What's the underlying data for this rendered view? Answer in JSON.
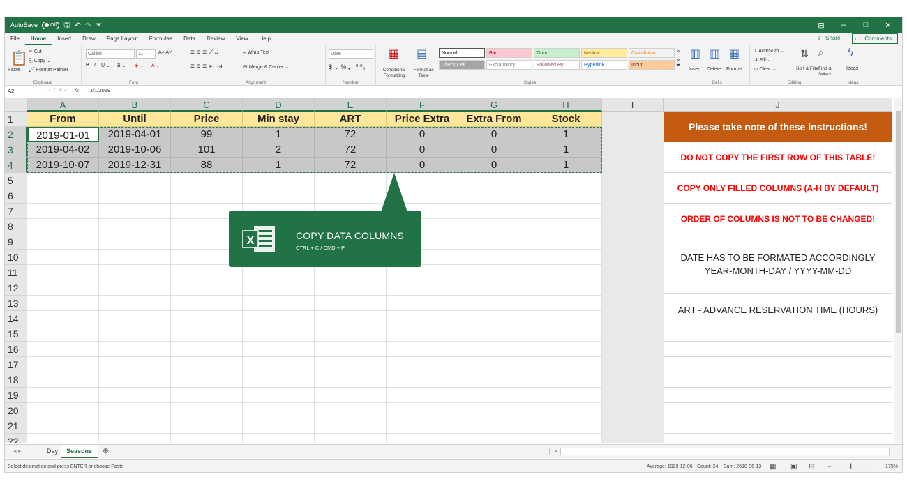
{
  "titlebar": {
    "autosave_label": "AutoSave",
    "autosave_state": "Off",
    "window_controls": [
      "⊟",
      "–",
      "□",
      "✕"
    ]
  },
  "ribbon_tabs": [
    "File",
    "Home",
    "Insert",
    "Draw",
    "Page Layout",
    "Formulas",
    "Data",
    "Review",
    "View",
    "Help"
  ],
  "share": {
    "share_label": "Share",
    "comments_label": "Comments"
  },
  "ribbon": {
    "clipboard": {
      "paste": "Paste",
      "cut": "Cut",
      "copy": "Copy",
      "format_painter": "Format Painter",
      "label": "Clipboard"
    },
    "font": {
      "font_name": "Calibri",
      "font_size": "11",
      "label": "Font"
    },
    "alignment": {
      "wrap_text": "Wrap Text",
      "merge_center": "Merge & Center",
      "label": "Alignment"
    },
    "number": {
      "format": "Date",
      "label": "Number"
    },
    "styles": {
      "conditional": "Conditional Formatting",
      "format_table": "Format as Table",
      "label": "Styles",
      "cells": [
        {
          "name": "Normal",
          "bg": "#ffffff",
          "fg": "#000000"
        },
        {
          "name": "Bad",
          "bg": "#ffc7ce",
          "fg": "#9c0006"
        },
        {
          "name": "Good",
          "bg": "#c6efce",
          "fg": "#006100"
        },
        {
          "name": "Neutral",
          "bg": "#ffeb9c",
          "fg": "#9c5700"
        },
        {
          "name": "Calculation",
          "bg": "#f2f2f2",
          "fg": "#fa7d00"
        },
        {
          "name": "Check Cell",
          "bg": "#a5a5a5",
          "fg": "#ffffff"
        },
        {
          "name": "Explanatory ...",
          "bg": "#ffffff",
          "fg": "#7f7f7f"
        },
        {
          "name": "Followed Hy...",
          "bg": "#ffffff",
          "fg": "#954f72"
        },
        {
          "name": "Hyperlink",
          "bg": "#ffffff",
          "fg": "#0563c1"
        },
        {
          "name": "Input",
          "bg": "#ffcc99",
          "fg": "#3f3f76"
        }
      ]
    },
    "cells": {
      "insert": "Insert",
      "delete": "Delete",
      "format": "Format",
      "label": "Cells"
    },
    "editing": {
      "autosum": "AutoSum",
      "fill": "Fill",
      "clear": "Clear",
      "sort_filter": "Sort & Filter",
      "find_select": "Find & Select",
      "label": "Editing"
    },
    "ideas": {
      "ideas": "Ideas",
      "label": "Ideas"
    }
  },
  "formula_bar": {
    "name_box": "A2",
    "fx": "fx",
    "value": "1/1/2019"
  },
  "columns": [
    "A",
    "B",
    "C",
    "D",
    "E",
    "F",
    "G",
    "H",
    "I",
    "J"
  ],
  "rows": [
    "1",
    "2",
    "3",
    "4",
    "5",
    "6",
    "7",
    "8",
    "9",
    "10",
    "11",
    "12",
    "13",
    "14",
    "15",
    "16",
    "17",
    "18",
    "19",
    "20",
    "21",
    "22"
  ],
  "table": {
    "headers": [
      "From",
      "Until",
      "Price",
      "Min stay",
      "ART",
      "Price Extra",
      "Extra From",
      "Stock"
    ],
    "rows": [
      [
        "2019-01-01",
        "2019-04-01",
        "99",
        "1",
        "72",
        "0",
        "0",
        "1"
      ],
      [
        "2019-04-02",
        "2019-10-06",
        "101",
        "2",
        "72",
        "0",
        "0",
        "1"
      ],
      [
        "2019-10-07",
        "2019-12-31",
        "88",
        "1",
        "72",
        "0",
        "0",
        "1"
      ]
    ]
  },
  "callout": {
    "title": "COPY DATA COLUMNS",
    "subtitle": "CTRL + C / CMD + P"
  },
  "instructions": {
    "heading": "Please take note of these instructions!",
    "line1": "DO NOT COPY THE FIRST ROW OF THIS TABLE!",
    "line2": "COPY ONLY FILLED COLUMNS (A-H BY DEFAULT)",
    "line3": "ORDER OF COLUMNS IS NOT TO BE CHANGED!",
    "line4a": "DATE HAS TO BE FORMATED ACCORDINGLY",
    "line4b": "YEAR-MONTH-DAY / YYYY-MM-DD",
    "line5": "ART - ADVANCE RESERVATION TIME (HOURS)",
    "heading_bg": "#c55a11",
    "warning_color": "#ff0000"
  },
  "sheet_tabs": [
    "Day",
    "Seasons"
  ],
  "status": {
    "message": "Select destination and press ENTER or choose Paste",
    "average": "Average: 1929-12-06",
    "count": "Count: 24",
    "sum": "Sum: 2618-06-13",
    "zoom": "175%"
  },
  "colors": {
    "excel_green": "#217346",
    "header_fill": "#ffe699",
    "selection_fill": "#c8c8c8"
  }
}
